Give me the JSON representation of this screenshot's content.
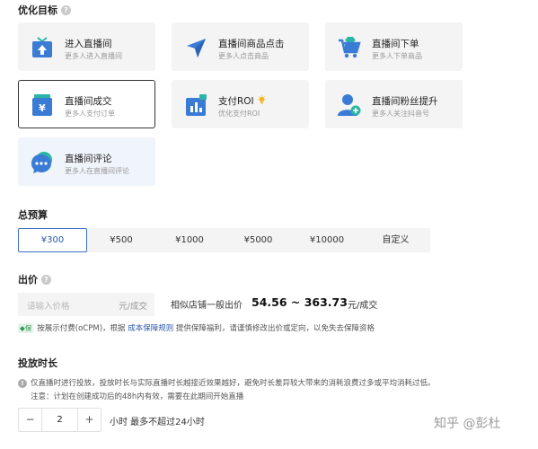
{
  "optimize": {
    "title": "优化目标",
    "help_icon": "?",
    "options": [
      {
        "title": "进入直播间",
        "subtitle": "更多人进入直播间",
        "icon": "enter-room-icon"
      },
      {
        "title": "直播间商品点击",
        "subtitle": "更多人点击商品",
        "icon": "cursor-click-icon"
      },
      {
        "title": "直播间下单",
        "subtitle": "更多人下单商品",
        "icon": "cart-icon"
      },
      {
        "title": "直播间成交",
        "subtitle": "更多人支付订单",
        "icon": "wallet-yen-icon",
        "selected": true
      },
      {
        "title": "支付ROI",
        "subtitle": "优化支付ROI",
        "icon": "roi-chart-icon",
        "badge_icon": "lightbulb-icon"
      },
      {
        "title": "直播间粉丝提升",
        "subtitle": "更多人关注抖音号",
        "icon": "add-follower-icon"
      },
      {
        "title": "直播间评论",
        "subtitle": "更多人在直播间评论",
        "icon": "comment-bubble-icon"
      }
    ]
  },
  "budget": {
    "title": "总预算",
    "options": [
      "¥300",
      "¥500",
      "¥1000",
      "¥5000",
      "¥10000",
      "自定义"
    ],
    "selected": "¥300"
  },
  "bid": {
    "title": "出价",
    "help_icon": "?",
    "placeholder": "请输入价格",
    "unit": "元/成交",
    "reference_label": "相似店铺一般出价",
    "range": "54.56 ~ 363.73",
    "range_unit": "元/成交",
    "guarantee": {
      "badge": "保",
      "text_before": "按展示付费(oCPM)，根据 ",
      "link": "成本保障规则",
      "text_after": " 提供保障福利，请谨慎修改出价或定向，以免失去保障资格"
    }
  },
  "duration": {
    "title": "投放时长",
    "note1": "仅直播时进行投放，投放时长与实际直播时长越接近效果越好，避免时长差异较大带来的消耗浪费过多或平均消耗过低。",
    "note2": "注意：计划在创建成功后的48h内有效，需要在此期间开始直播",
    "minus": "−",
    "plus": "+",
    "value": "2",
    "label": "小时  最多不超过24小时"
  },
  "watermark": "知乎 @彭杜",
  "colors": {
    "accent": "#2a5aa8",
    "selected_border": "#333333",
    "icon_blue": "#3a7bd5",
    "icon_teal": "#2bb5a4"
  }
}
